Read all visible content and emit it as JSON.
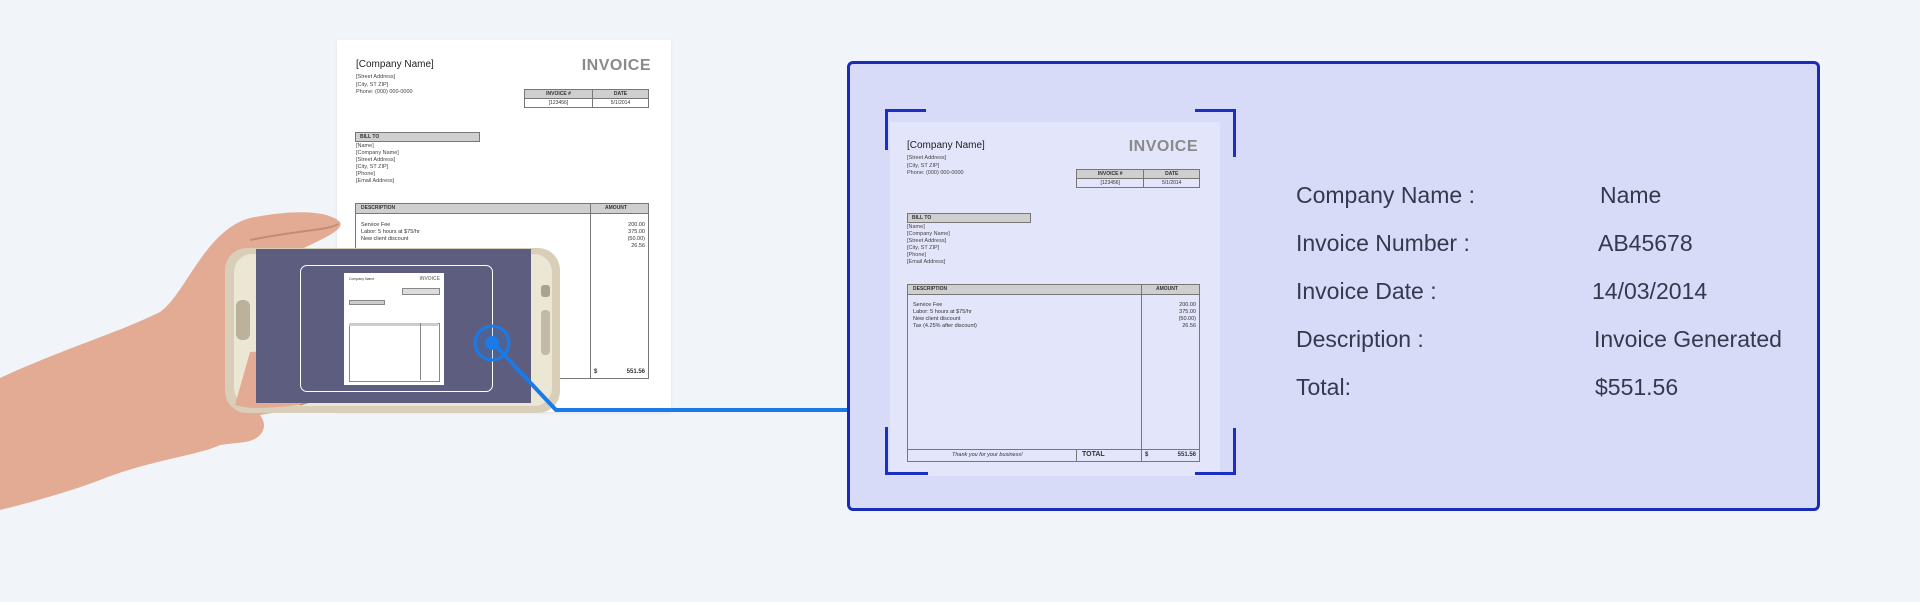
{
  "invoice": {
    "company_placeholder": "[Company Name]",
    "title": "INVOICE",
    "address_lines": [
      "[Street Address]",
      "[City, ST  ZIP]",
      "Phone: (000) 000-0000"
    ],
    "invoice_no_header": "INVOICE #",
    "date_header": "DATE",
    "invoice_no_value": "[123456]",
    "date_value": "5/1/2014",
    "bill_to_header": "BILL TO",
    "bill_to_lines": [
      "[Name]",
      "[Company Name]",
      "[Street Address]",
      "[City, ST  ZIP]",
      "[Phone]",
      "[Email Address]"
    ],
    "description_header": "DESCRIPTION",
    "amount_header": "AMOUNT",
    "items": [
      {
        "desc": "Service Fee",
        "amount": "200.00"
      },
      {
        "desc": "Labor: 5 hours at $75/hr",
        "amount": "375.00"
      },
      {
        "desc": "New client discount",
        "amount": "(50.00)"
      },
      {
        "desc": "Tax (4.25% after discount)",
        "amount": "26.56"
      }
    ],
    "thank_you": "Thank you for your business!",
    "total_label": "TOTAL",
    "currency": "$",
    "total_value": "551.56"
  },
  "mini_invoice": {
    "company_placeholder": "Company Name",
    "title": "INVOICE"
  },
  "extracted_fields": [
    {
      "label": "Company Name :",
      "value": "Name"
    },
    {
      "label": "Invoice Number :",
      "value": "AB45678"
    },
    {
      "label": "Invoice Date :",
      "value": "14/03/2014"
    },
    {
      "label": "Description :",
      "value": "Invoice Generated"
    },
    {
      "label": "Total:",
      "value": "$551.56"
    }
  ],
  "colors": {
    "accent_blue": "#1a7ae8",
    "frame_blue": "#1a2cb5",
    "panel_bg": "#d7dbf7",
    "phone_screen": "#5c5d7f",
    "page_bg": "#f1f4f8"
  },
  "icons": [
    "hand-holding-phone-icon",
    "scan-target-icon",
    "scan-corner-icon"
  ]
}
